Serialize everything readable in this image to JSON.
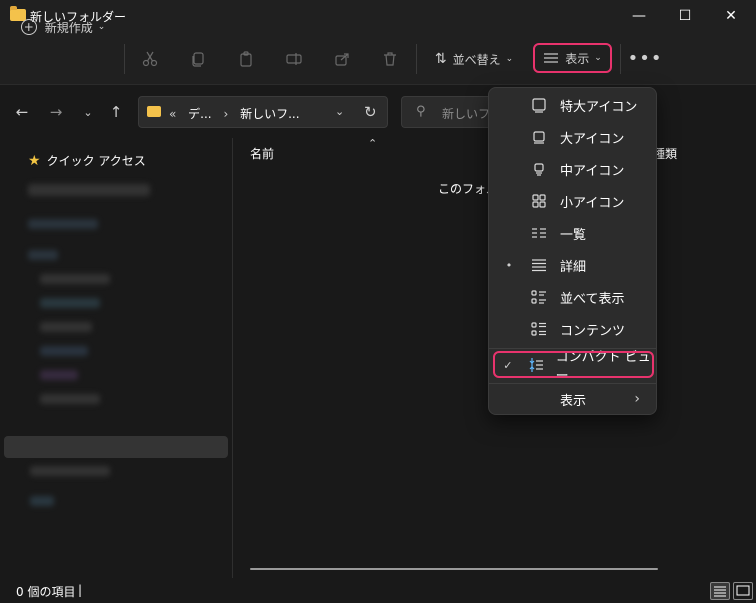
{
  "window": {
    "title": "新しいフォルダー",
    "controls": {
      "minimize": "—",
      "maximize": "☐",
      "close": "✕"
    }
  },
  "toolbar": {
    "new_label": "新規作成",
    "sort_label": "並べ替え",
    "view_label": "表示",
    "more_label": "•••",
    "highlight_color": "#e8336d"
  },
  "address": {
    "overflow": "«",
    "crumbs": [
      "デ...",
      "新しいフ..."
    ]
  },
  "search": {
    "placeholder": "新しいフォル"
  },
  "sidebar": {
    "quick_access": "クイック アクセス"
  },
  "content": {
    "column_name": "名前",
    "column_type": "種類",
    "empty_message": "このフォルダ"
  },
  "status": {
    "item_count": "0 個の項目",
    "caret": "|"
  },
  "view_menu": {
    "items": [
      {
        "label": "特大アイコン",
        "icon": "extra-large-icons-icon",
        "marker": ""
      },
      {
        "label": "大アイコン",
        "icon": "large-icons-icon",
        "marker": ""
      },
      {
        "label": "中アイコン",
        "icon": "medium-icons-icon",
        "marker": ""
      },
      {
        "label": "小アイコン",
        "icon": "small-icons-icon",
        "marker": ""
      },
      {
        "label": "一覧",
        "icon": "list-icon",
        "marker": ""
      },
      {
        "label": "詳細",
        "icon": "details-icon",
        "marker": "•"
      },
      {
        "label": "並べて表示",
        "icon": "tiles-icon",
        "marker": ""
      },
      {
        "label": "コンテンツ",
        "icon": "content-icon",
        "marker": ""
      }
    ],
    "compact": {
      "label": "コンパクト ビュー",
      "marker": "✓",
      "icon": "compact-view-icon"
    },
    "show": {
      "label": "表示",
      "arrow": "›"
    }
  }
}
